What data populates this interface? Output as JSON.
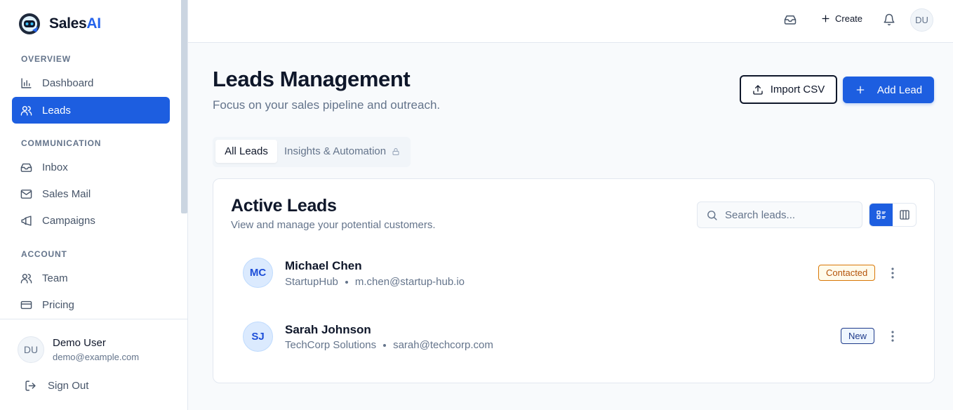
{
  "brand": {
    "name_prefix": "Sales",
    "name_suffix": "AI"
  },
  "sidebar": {
    "sections": {
      "overview": "OVERVIEW",
      "communication": "COMMUNICATION",
      "account": "ACCOUNT"
    },
    "items": [
      {
        "label": "Dashboard",
        "icon": "bar-chart-icon",
        "active": false
      },
      {
        "label": "Leads",
        "icon": "users-icon",
        "active": true
      },
      {
        "label": "Inbox",
        "icon": "inbox-icon",
        "active": false
      },
      {
        "label": "Sales Mail",
        "icon": "mail-icon",
        "active": false
      },
      {
        "label": "Campaigns",
        "icon": "megaphone-icon",
        "active": false
      },
      {
        "label": "Team",
        "icon": "users-icon",
        "active": false
      },
      {
        "label": "Pricing",
        "icon": "credit-card-icon",
        "active": false
      }
    ],
    "user": {
      "initials": "DU",
      "name": "Demo User",
      "email": "demo@example.com"
    },
    "sign_out": "Sign Out"
  },
  "topbar": {
    "create_label": "Create",
    "avatar_initials": "DU"
  },
  "main": {
    "title": "Leads Management",
    "subtitle": "Focus on your sales pipeline and outreach.",
    "import_label": "Import CSV",
    "add_label": "Add Lead",
    "tabs": [
      {
        "label": "All Leads",
        "active": true
      },
      {
        "label": "Insights & Automation",
        "active": false,
        "locked": true
      }
    ],
    "card": {
      "title": "Active Leads",
      "subtitle": "View and manage your potential customers.",
      "search_placeholder": "Search leads...",
      "view_modes": [
        "list-view",
        "board-view"
      ],
      "leads": [
        {
          "initials": "MC",
          "name": "Michael Chen",
          "company": "StartupHub",
          "email": "m.chen@startup-hub.io",
          "status": "Contacted"
        },
        {
          "initials": "SJ",
          "name": "Sarah Johnson",
          "company": "TechCorp Solutions",
          "email": "sarah@techcorp.com",
          "status": "New"
        }
      ]
    }
  },
  "colors": {
    "accent": "#1d5ee0",
    "brand_ai": "#2563eb",
    "contacted": "#d97706",
    "new": "#1e3a8a"
  }
}
